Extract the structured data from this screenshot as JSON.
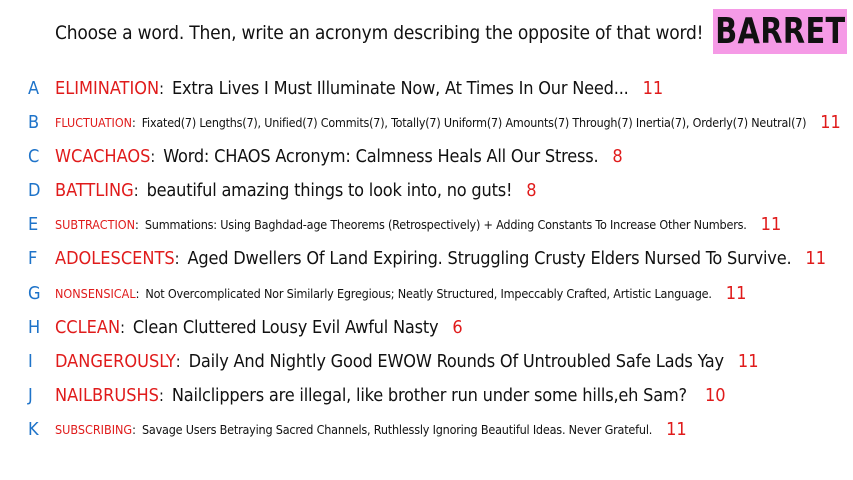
{
  "prompt": "Choose a word. Then, write an acronym describing the opposite of that word!",
  "name_badge": "BARRET",
  "colors": {
    "letter": "#1e73c9",
    "word": "#e01b1b",
    "score": "#e01b1b",
    "badge_background": "#f59ae6"
  },
  "answers": [
    {
      "letter": "A",
      "word": "ELIMINATION",
      "definition": "Extra Lives I Must Illuminate Now, At Times In Our Need...",
      "score": "11"
    },
    {
      "letter": "B",
      "word": "FLUCTUATION",
      "definition": "Fixated(7) Lengths(7), Unified(7) Commits(7), Totally(7) Uniform(7) Amounts(7) Through(7) Inertia(7), Orderly(7) Neutral(7)",
      "score": "11"
    },
    {
      "letter": "C",
      "word": "WCACHAOS",
      "definition": "Word: CHAOS  Acronym: Calmness Heals All Our Stress.",
      "score": "8"
    },
    {
      "letter": "D",
      "word": "BATTLING",
      "definition": "beautiful amazing things to look into, no guts!",
      "score": "8"
    },
    {
      "letter": "E",
      "word": "SUBTRACTION",
      "definition": "Summations: Using Baghdad-age Theorems (Retrospectively) + Adding Constants To Increase Other Numbers.",
      "score": "11"
    },
    {
      "letter": "F",
      "word": "ADOLESCENTS",
      "definition": "Aged Dwellers Of Land Expiring. Struggling Crusty Elders Nursed To Survive.",
      "score": "11"
    },
    {
      "letter": "G",
      "word": "NONSENSICAL",
      "definition": "Not Overcomplicated Nor Similarly Egregious; Neatly Structured, Impeccably Crafted, Artistic Language.",
      "score": "11"
    },
    {
      "letter": "H",
      "word": "CCLEAN",
      "definition": "Clean Cluttered Lousy Evil Awful Nasty",
      "score": "6"
    },
    {
      "letter": "I",
      "word": "DANGEROUSLY",
      "definition": "Daily And Nightly Good EWOW Rounds Of Untroubled Safe Lads Yay",
      "score": "11"
    },
    {
      "letter": "J",
      "word": "NAILBRUSHS",
      "definition": "Nailclippers are illegal, like brother run under some hills,eh Sam?",
      "score": "10"
    },
    {
      "letter": "K",
      "word": "SUBSCRIBING",
      "definition": "Savage Users Betraying Sacred Channels, Ruthlessly Ignoring Beautiful Ideas. Never Grateful.",
      "score": "11"
    }
  ]
}
